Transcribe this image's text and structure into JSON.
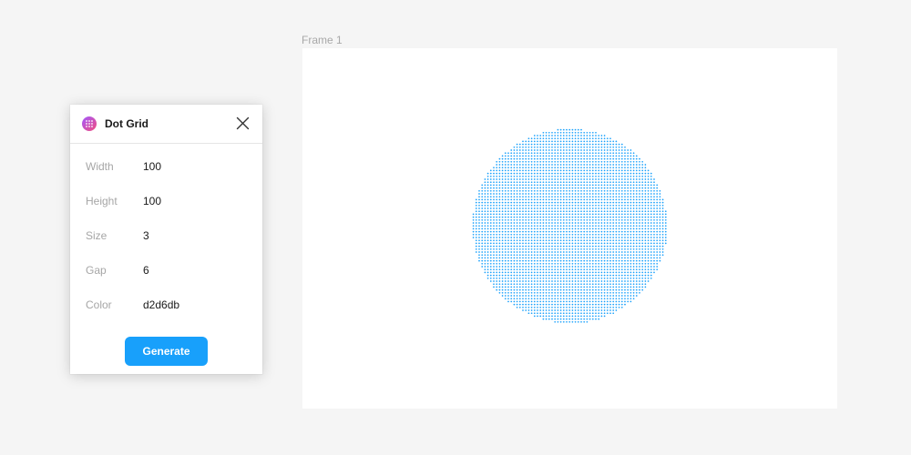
{
  "canvas": {
    "frame_label": "Frame 1",
    "background_color": "#f5f5f5",
    "frame_color": "#ffffff",
    "dot_pattern": {
      "shape": "circle",
      "dot_color": "#18a0fb"
    }
  },
  "plugin": {
    "title": "Dot Grid",
    "icon": "dot-grid-plugin-icon",
    "close_icon": "close-icon",
    "fields": [
      {
        "label": "Width",
        "value": "100"
      },
      {
        "label": "Height",
        "value": "100"
      },
      {
        "label": "Size",
        "value": "3"
      },
      {
        "label": "Gap",
        "value": "6"
      },
      {
        "label": "Color",
        "value": "d2d6db"
      }
    ],
    "generate_label": "Generate",
    "accent_color": "#18a0fb"
  }
}
